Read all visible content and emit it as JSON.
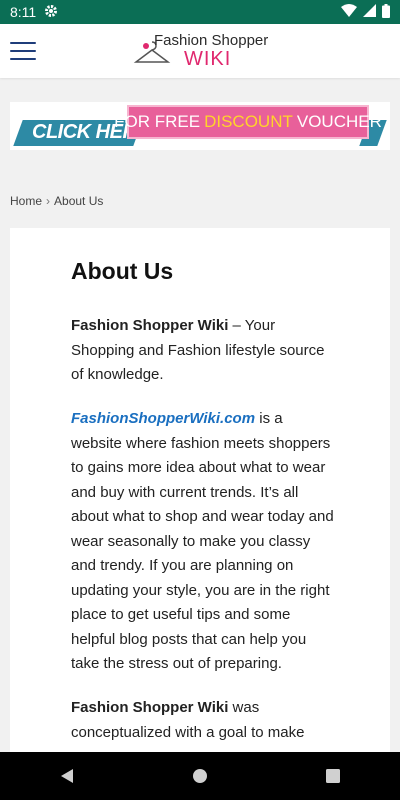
{
  "status_bar": {
    "time": "8:11",
    "icons": [
      "settings-gear-icon",
      "wifi-icon",
      "signal-icon",
      "battery-icon"
    ]
  },
  "header": {
    "menu_icon": "hamburger-menu-icon",
    "logo_line1": "Fashion Shopper",
    "logo_line2": "WIKI",
    "brand_color": "#e0286e"
  },
  "banner": {
    "click_here": "CLICK HERE",
    "text_before": "FOR FREE",
    "text_highlight": "DISCOUNT",
    "text_after": "VOUCHER",
    "pink_color": "#e8609a",
    "teal_color": "#2d8aa5"
  },
  "breadcrumb": {
    "home": "Home",
    "current": "About Us"
  },
  "article": {
    "title": "About Us",
    "p1_bold": "Fashion Shopper Wiki",
    "p1_rest": " – Your Shopping and Fashion lifestyle source of knowledge.",
    "p2_link": "FashionShopperWiki.com",
    "p2_rest": " is  a website where fashion meets shoppers to gains more idea about what to wear and buy with current trends. It’s all about what to shop and wear today and wear seasonally to make you classy and trendy. If you are planning on updating your style, you are in the right place to get useful tips and some helpful blog posts that can help you take the stress out of preparing.",
    "p3_bold": "Fashion Shopper Wiki",
    "p3_rest": " was conceptualized with a goal to make",
    "link_color": "#1a6fc0"
  },
  "nav_bar": {
    "back": "back-icon",
    "home": "home-icon",
    "recents": "recents-icon"
  }
}
